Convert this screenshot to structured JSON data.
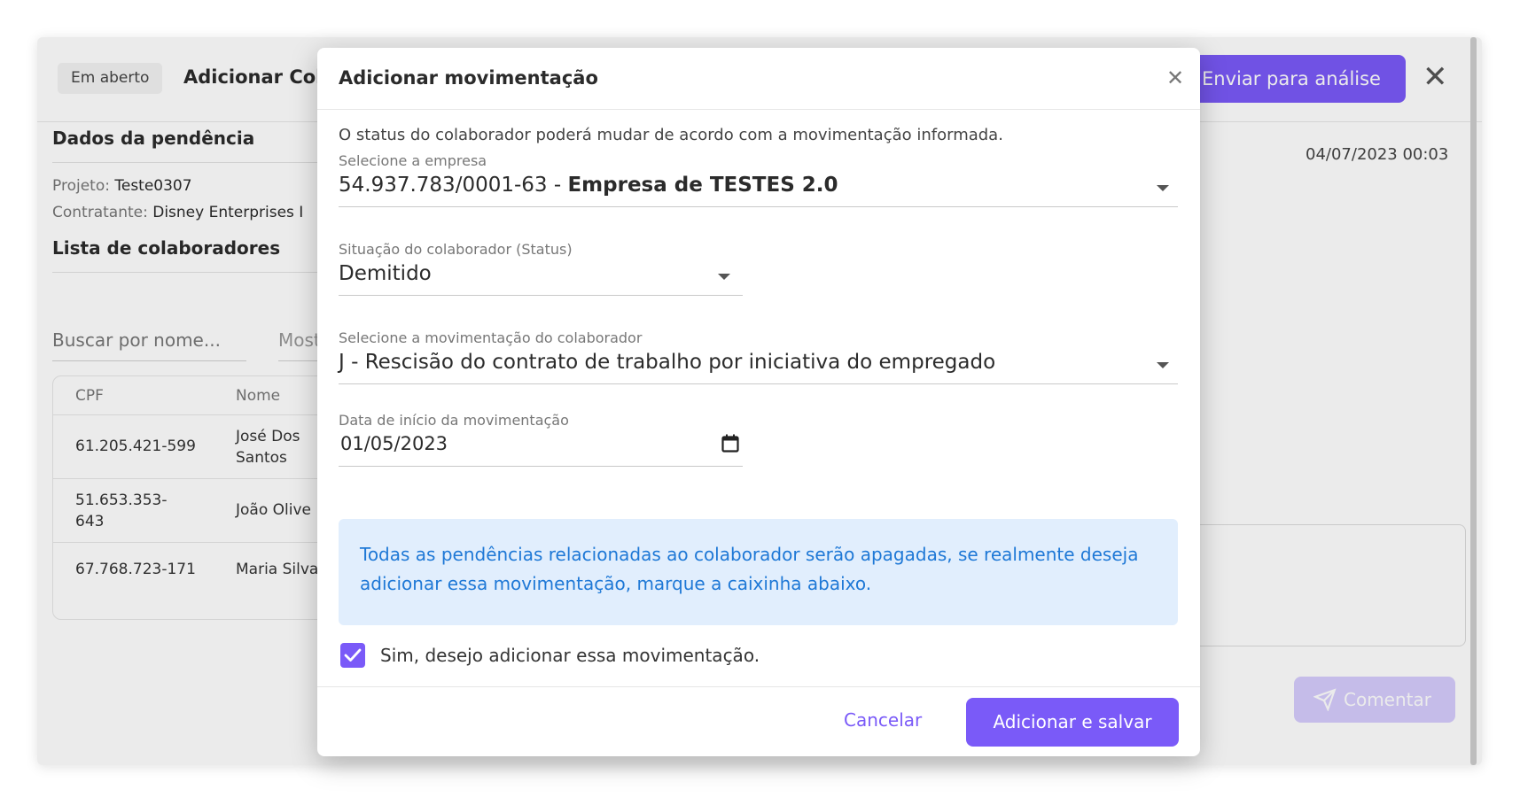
{
  "header": {
    "badge": "Em aberto",
    "title": "Adicionar Cola",
    "send_button": "Enviar para análise"
  },
  "details": {
    "section_title": "Dados da pendência",
    "project_label": "Projeto:",
    "project_value": "Teste0307",
    "contractor_label": "Contratante:",
    "contractor_value": "Disney Enterprises I"
  },
  "collaborators": {
    "section_title": "Lista de colaboradores",
    "search_placeholder": "Buscar por nome...",
    "show_label": "Most",
    "columns": [
      "CPF",
      "Nome"
    ],
    "rows": [
      {
        "cpf": "61.205.421-599",
        "name": "José Dos Santos"
      },
      {
        "cpf": "51.653.353-643",
        "name": "João Olive"
      },
      {
        "cpf": "67.768.723-171",
        "name": "Maria Silva"
      }
    ]
  },
  "sidebar": {
    "date": "04/07/2023 00:03",
    "comment_button": "Comentar"
  },
  "modal": {
    "title": "Adicionar movimentação",
    "info": "O status do colaborador poderá mudar de acordo com a movimentação informada.",
    "company_label": "Selecione a empresa",
    "company_cnpj": "54.937.783/0001-63 - ",
    "company_name": "Empresa de TESTES 2.0",
    "status_label": "Situação do colaborador (Status)",
    "status_value": "Demitido",
    "movement_label": "Selecione a movimentação do colaborador",
    "movement_value": "J - Rescisão do contrato de trabalho por iniciativa do empregado",
    "date_label": "Data de início da movimentação",
    "date_value": "01/05/2023",
    "alert_text": "Todas as pendências relacionadas ao colaborador serão apagadas, se realmente deseja adicionar essa movimentação, marque a caixinha abaixo.",
    "checkbox_label": "Sim, desejo adicionar essa movimentação.",
    "checkbox_checked": true,
    "cancel_button": "Cancelar",
    "save_button": "Adicionar e salvar"
  },
  "colors": {
    "accent": "#7a5af8",
    "alert_bg": "#e1eefd",
    "alert_text": "#1e78d6"
  }
}
